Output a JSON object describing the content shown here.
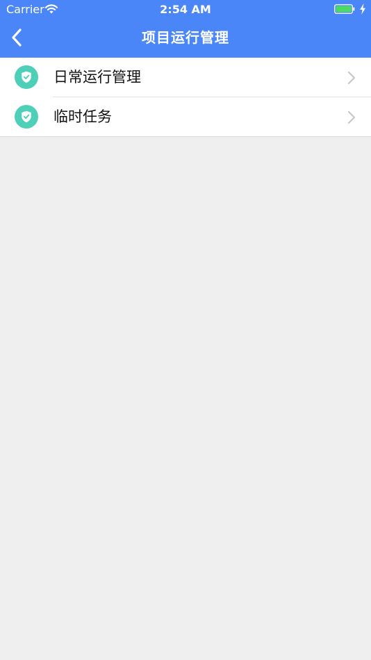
{
  "status_bar": {
    "carrier": "Carrier",
    "time": "2:54 AM",
    "battery_color": "#4cd964"
  },
  "nav": {
    "title": "项目运行管理",
    "background_color": "#4a86f7"
  },
  "menu": {
    "icon_color": "#4ecfb8",
    "items": [
      {
        "label": "日常运行管理",
        "icon": "shield-check-icon"
      },
      {
        "label": "临时任务",
        "icon": "shield-check-icon"
      }
    ]
  }
}
